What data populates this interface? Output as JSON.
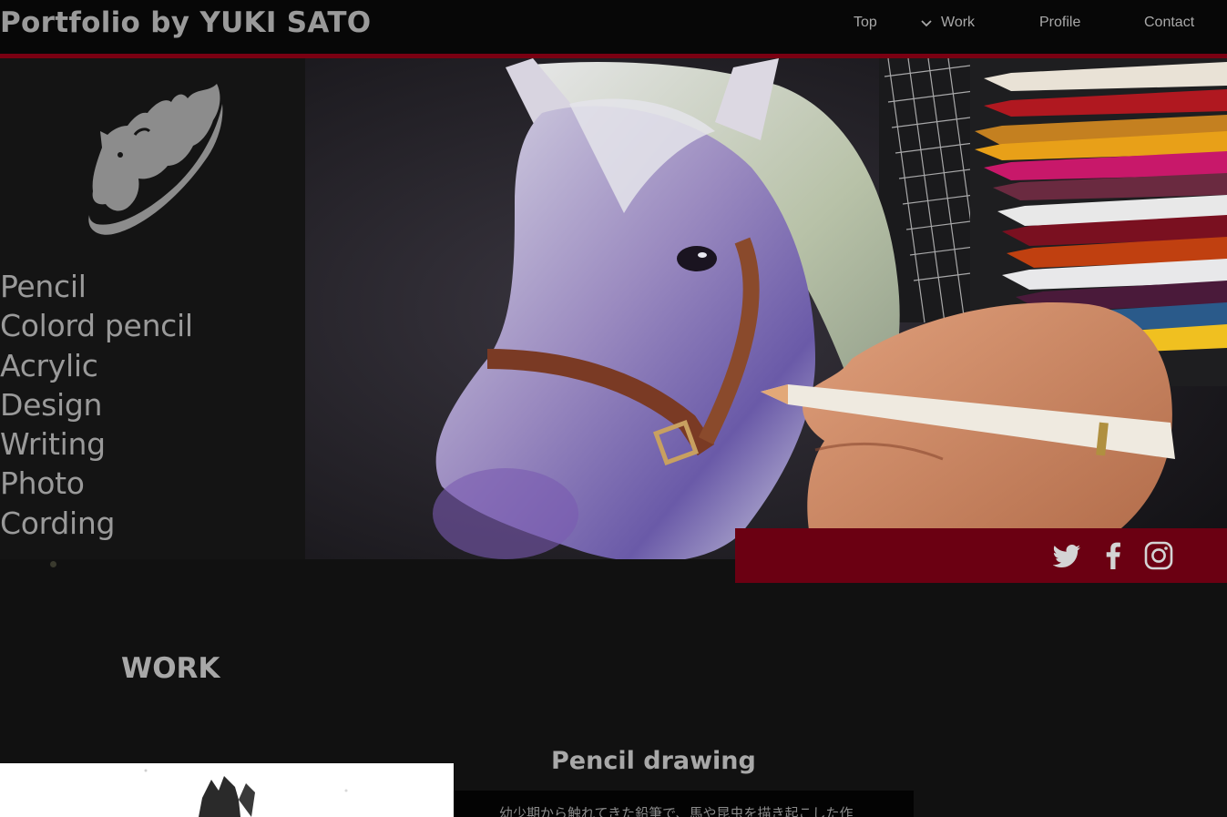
{
  "header": {
    "site_title": "Portfolio by YUKI SATO",
    "nav": [
      {
        "label": "Top"
      },
      {
        "label": "Work"
      },
      {
        "label": "Profile"
      },
      {
        "label": "Contact"
      }
    ]
  },
  "sidebar": {
    "logo_icon": "horse-flame-logo",
    "categories": [
      "Pencil",
      "Colord pencil",
      "Acrylic",
      "Design",
      "Writing",
      "Photo",
      "Cording"
    ]
  },
  "social": {
    "icons": [
      "twitter-icon",
      "facebook-icon",
      "instagram-icon"
    ]
  },
  "work": {
    "heading": "WORK",
    "section_title": "Pencil drawing",
    "description": "幼少期から触れてきた鉛筆で、馬や昆虫を描き起こした作"
  },
  "colors": {
    "accent": "#7a0012",
    "social_bar": "#6b0012",
    "background": "#111111",
    "text": "#9a9a9a"
  }
}
